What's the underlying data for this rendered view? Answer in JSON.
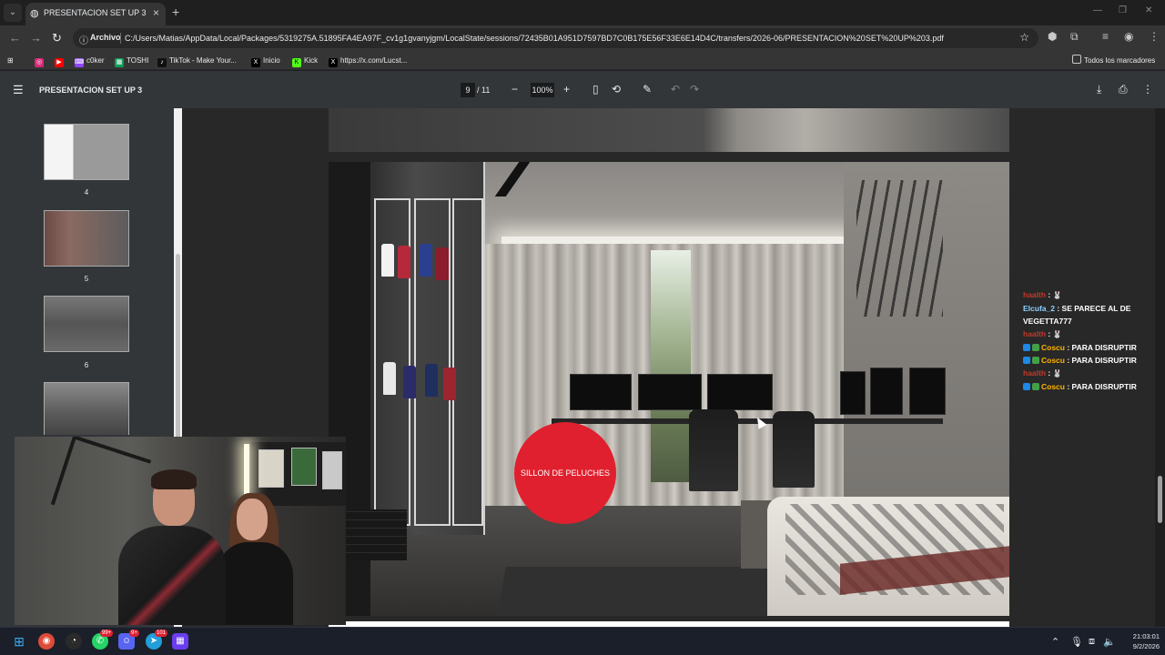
{
  "browser": {
    "tab": {
      "title": "PRESENTACION SET UP 3",
      "icon": "globe-icon"
    },
    "address": {
      "chip": "Archivo",
      "url": "C:/Users/Matias/AppData/Local/Packages/5319275A.51895FA4EA97F_cv1g1gvanyjgm/LocalState/sessions/72435B01A951D7597BD7C0B175E56F33E6E14D4C/transfers/2026-06/PRESENTACION%20SET%20UP%203.pdf"
    },
    "bookmarks": [
      {
        "label": "",
        "icon": "instagram-icon",
        "color": "#d62976"
      },
      {
        "label": "",
        "icon": "youtube-icon",
        "color": "#ff0000"
      },
      {
        "label": "c0ker",
        "icon": "twitch-icon",
        "color": "#9146ff"
      },
      {
        "label": "TOSHI",
        "icon": "sheets-icon",
        "color": "#0f9d58"
      },
      {
        "label": "TikTok - Make Your...",
        "icon": "tiktok-icon",
        "color": "#111111"
      },
      {
        "label": "Inicio",
        "icon": "x-icon",
        "color": "#000000"
      },
      {
        "label": "Kick",
        "icon": "kick-icon",
        "color": "#53fc18"
      },
      {
        "label": "https://x.com/Lucst...",
        "icon": "x-icon",
        "color": "#000000"
      }
    ],
    "bookmarks_folder": "Todos los marcadores"
  },
  "pdf": {
    "title": "PRESENTACION SET UP 3",
    "page_current": "9",
    "page_total": "/ 11",
    "zoom": "100%",
    "thumbnails": [
      {
        "num": "4"
      },
      {
        "num": "5"
      },
      {
        "num": "6"
      },
      {
        "num": ""
      }
    ],
    "callout": "SILLON DE PELUCHES"
  },
  "chat": [
    {
      "user": "haalth",
      "user_color": "#c0392b",
      "text": "",
      "emote": "🐰",
      "badges": []
    },
    {
      "user": "Elcufa_2",
      "user_color": "#8fd3ff",
      "text": "SE PARECE AL DE VEGETTA777",
      "emote": "",
      "badges": []
    },
    {
      "user": "haalth",
      "user_color": "#c0392b",
      "text": "",
      "emote": "🐰",
      "badges": []
    },
    {
      "user": "Coscu",
      "user_color": "#ffb300",
      "text": "PARA DISRUPTIR",
      "emote": "",
      "badges": [
        "#1e88e5",
        "#43a047"
      ]
    },
    {
      "user": "Coscu",
      "user_color": "#ffb300",
      "text": "PARA DISRUPTIR",
      "emote": "",
      "badges": [
        "#1e88e5",
        "#43a047"
      ]
    },
    {
      "user": "haalth",
      "user_color": "#c0392b",
      "text": "",
      "emote": "🐰",
      "badges": []
    },
    {
      "user": "Coscu",
      "user_color": "#ffb300",
      "text": "PARA DISRUPTIR",
      "emote": "",
      "badges": [
        "#1e88e5",
        "#43a047"
      ]
    }
  ],
  "taskbar": {
    "badges": [
      "99+",
      "9+",
      "101"
    ],
    "time": "21:03:01",
    "date": "9/2/2026"
  }
}
